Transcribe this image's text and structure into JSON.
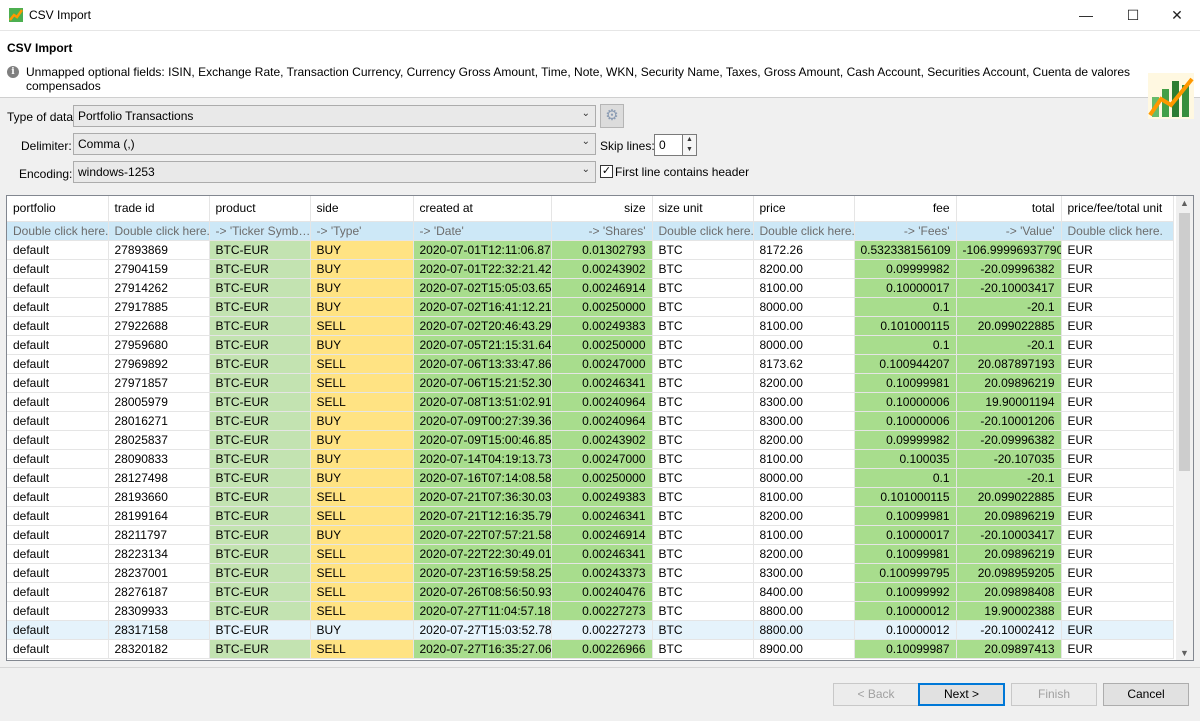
{
  "window": {
    "title": "CSV Import",
    "minimize": "—",
    "maximize": "☐",
    "close": "✕"
  },
  "header": {
    "title": "CSV Import",
    "info": "Unmapped optional fields: ISIN, Exchange Rate, Transaction Currency, Currency Gross Amount, Time, Note, WKN, Security Name, Taxes, Gross Amount, Cash Account, Securities Account, Cuenta de valores compensados"
  },
  "form": {
    "type_label": "Type of data:",
    "type_value": "Portfolio Transactions",
    "delimiter_label": "Delimiter:",
    "delimiter_value": "Comma (,)",
    "encoding_label": "Encoding:",
    "encoding_value": "windows-1253",
    "skip_label": "Skip lines:",
    "skip_value": "0",
    "header_label": "First line contains header",
    "header_checked": true
  },
  "table": {
    "columns": [
      "portfolio",
      "trade id",
      "product",
      "side",
      "created at",
      "size",
      "size unit",
      "price",
      "fee",
      "total",
      "price/fee/total unit"
    ],
    "hints": [
      "Double click here.",
      "Double click here.",
      "-> 'Ticker Symb…",
      "-> 'Type'",
      "-> 'Date'",
      "-> 'Shares'",
      "Double click here.",
      "Double click here.",
      "-> 'Fees'",
      "-> 'Value'",
      "Double click here."
    ],
    "rows": [
      [
        "default",
        "27893869",
        "BTC-EUR",
        "BUY",
        "2020-07-01T12:11:06.875Z",
        "0.01302793",
        "BTC",
        "8172.26",
        "0.532338156109",
        "-106.999969377909",
        "EUR"
      ],
      [
        "default",
        "27904159",
        "BTC-EUR",
        "BUY",
        "2020-07-01T22:32:21.423Z",
        "0.00243902",
        "BTC",
        "8200.00",
        "0.09999982",
        "-20.09996382",
        "EUR"
      ],
      [
        "default",
        "27914262",
        "BTC-EUR",
        "BUY",
        "2020-07-02T15:05:03.659Z",
        "0.00246914",
        "BTC",
        "8100.00",
        "0.10000017",
        "-20.10003417",
        "EUR"
      ],
      [
        "default",
        "27917885",
        "BTC-EUR",
        "BUY",
        "2020-07-02T16:41:12.213Z",
        "0.00250000",
        "BTC",
        "8000.00",
        "0.1",
        "-20.1",
        "EUR"
      ],
      [
        "default",
        "27922688",
        "BTC-EUR",
        "SELL",
        "2020-07-02T20:46:43.297Z",
        "0.00249383",
        "BTC",
        "8100.00",
        "0.101000115",
        "20.099022885",
        "EUR"
      ],
      [
        "default",
        "27959680",
        "BTC-EUR",
        "BUY",
        "2020-07-05T21:15:31.646Z",
        "0.00250000",
        "BTC",
        "8000.00",
        "0.1",
        "-20.1",
        "EUR"
      ],
      [
        "default",
        "27969892",
        "BTC-EUR",
        "SELL",
        "2020-07-06T13:33:47.865Z",
        "0.00247000",
        "BTC",
        "8173.62",
        "0.100944207",
        "20.087897193",
        "EUR"
      ],
      [
        "default",
        "27971857",
        "BTC-EUR",
        "SELL",
        "2020-07-06T15:21:52.300Z",
        "0.00246341",
        "BTC",
        "8200.00",
        "0.10099981",
        "20.09896219",
        "EUR"
      ],
      [
        "default",
        "28005979",
        "BTC-EUR",
        "SELL",
        "2020-07-08T13:51:02.917Z",
        "0.00240964",
        "BTC",
        "8300.00",
        "0.10000006",
        "19.90001194",
        "EUR"
      ],
      [
        "default",
        "28016271",
        "BTC-EUR",
        "BUY",
        "2020-07-09T00:27:39.364Z",
        "0.00240964",
        "BTC",
        "8300.00",
        "0.10000006",
        "-20.10001206",
        "EUR"
      ],
      [
        "default",
        "28025837",
        "BTC-EUR",
        "BUY",
        "2020-07-09T15:00:46.852Z",
        "0.00243902",
        "BTC",
        "8200.00",
        "0.09999982",
        "-20.09996382",
        "EUR"
      ],
      [
        "default",
        "28090833",
        "BTC-EUR",
        "BUY",
        "2020-07-14T04:19:13.739Z",
        "0.00247000",
        "BTC",
        "8100.00",
        "0.100035",
        "-20.107035",
        "EUR"
      ],
      [
        "default",
        "28127498",
        "BTC-EUR",
        "BUY",
        "2020-07-16T07:14:08.587Z",
        "0.00250000",
        "BTC",
        "8000.00",
        "0.1",
        "-20.1",
        "EUR"
      ],
      [
        "default",
        "28193660",
        "BTC-EUR",
        "SELL",
        "2020-07-21T07:36:30.035Z",
        "0.00249383",
        "BTC",
        "8100.00",
        "0.101000115",
        "20.099022885",
        "EUR"
      ],
      [
        "default",
        "28199164",
        "BTC-EUR",
        "SELL",
        "2020-07-21T12:16:35.792Z",
        "0.00246341",
        "BTC",
        "8200.00",
        "0.10099981",
        "20.09896219",
        "EUR"
      ],
      [
        "default",
        "28211797",
        "BTC-EUR",
        "BUY",
        "2020-07-22T07:57:21.584Z",
        "0.00246914",
        "BTC",
        "8100.00",
        "0.10000017",
        "-20.10003417",
        "EUR"
      ],
      [
        "default",
        "28223134",
        "BTC-EUR",
        "SELL",
        "2020-07-22T22:30:49.016Z",
        "0.00246341",
        "BTC",
        "8200.00",
        "0.10099981",
        "20.09896219",
        "EUR"
      ],
      [
        "default",
        "28237001",
        "BTC-EUR",
        "SELL",
        "2020-07-23T16:59:58.253Z",
        "0.00243373",
        "BTC",
        "8300.00",
        "0.100999795",
        "20.098959205",
        "EUR"
      ],
      [
        "default",
        "28276187",
        "BTC-EUR",
        "SELL",
        "2020-07-26T08:56:50.938Z",
        "0.00240476",
        "BTC",
        "8400.00",
        "0.10099992",
        "20.09898408",
        "EUR"
      ],
      [
        "default",
        "28309933",
        "BTC-EUR",
        "SELL",
        "2020-07-27T11:04:57.187Z",
        "0.00227273",
        "BTC",
        "8800.00",
        "0.10000012",
        "19.90002388",
        "EUR"
      ],
      [
        "default",
        "28317158",
        "BTC-EUR",
        "BUY",
        "2020-07-27T15:03:52.780Z",
        "0.00227273",
        "BTC",
        "8800.00",
        "0.10000012",
        "-20.10002412",
        "EUR"
      ],
      [
        "default",
        "28320182",
        "BTC-EUR",
        "SELL",
        "2020-07-27T16:35:27.065Z",
        "0.00226966",
        "BTC",
        "8900.00",
        "0.10099987",
        "20.09897413",
        "EUR"
      ]
    ],
    "selected_row_index": 20
  },
  "buttons": {
    "back": "< Back",
    "next": "Next >",
    "finish": "Finish",
    "cancel": "Cancel"
  },
  "colors": {
    "mapped_green": "#a8dd8d",
    "product_green": "#c3e3b1",
    "side_yellow": "#ffe383",
    "hint_blue": "#cde8f7",
    "selection": "#e5f3fb"
  }
}
